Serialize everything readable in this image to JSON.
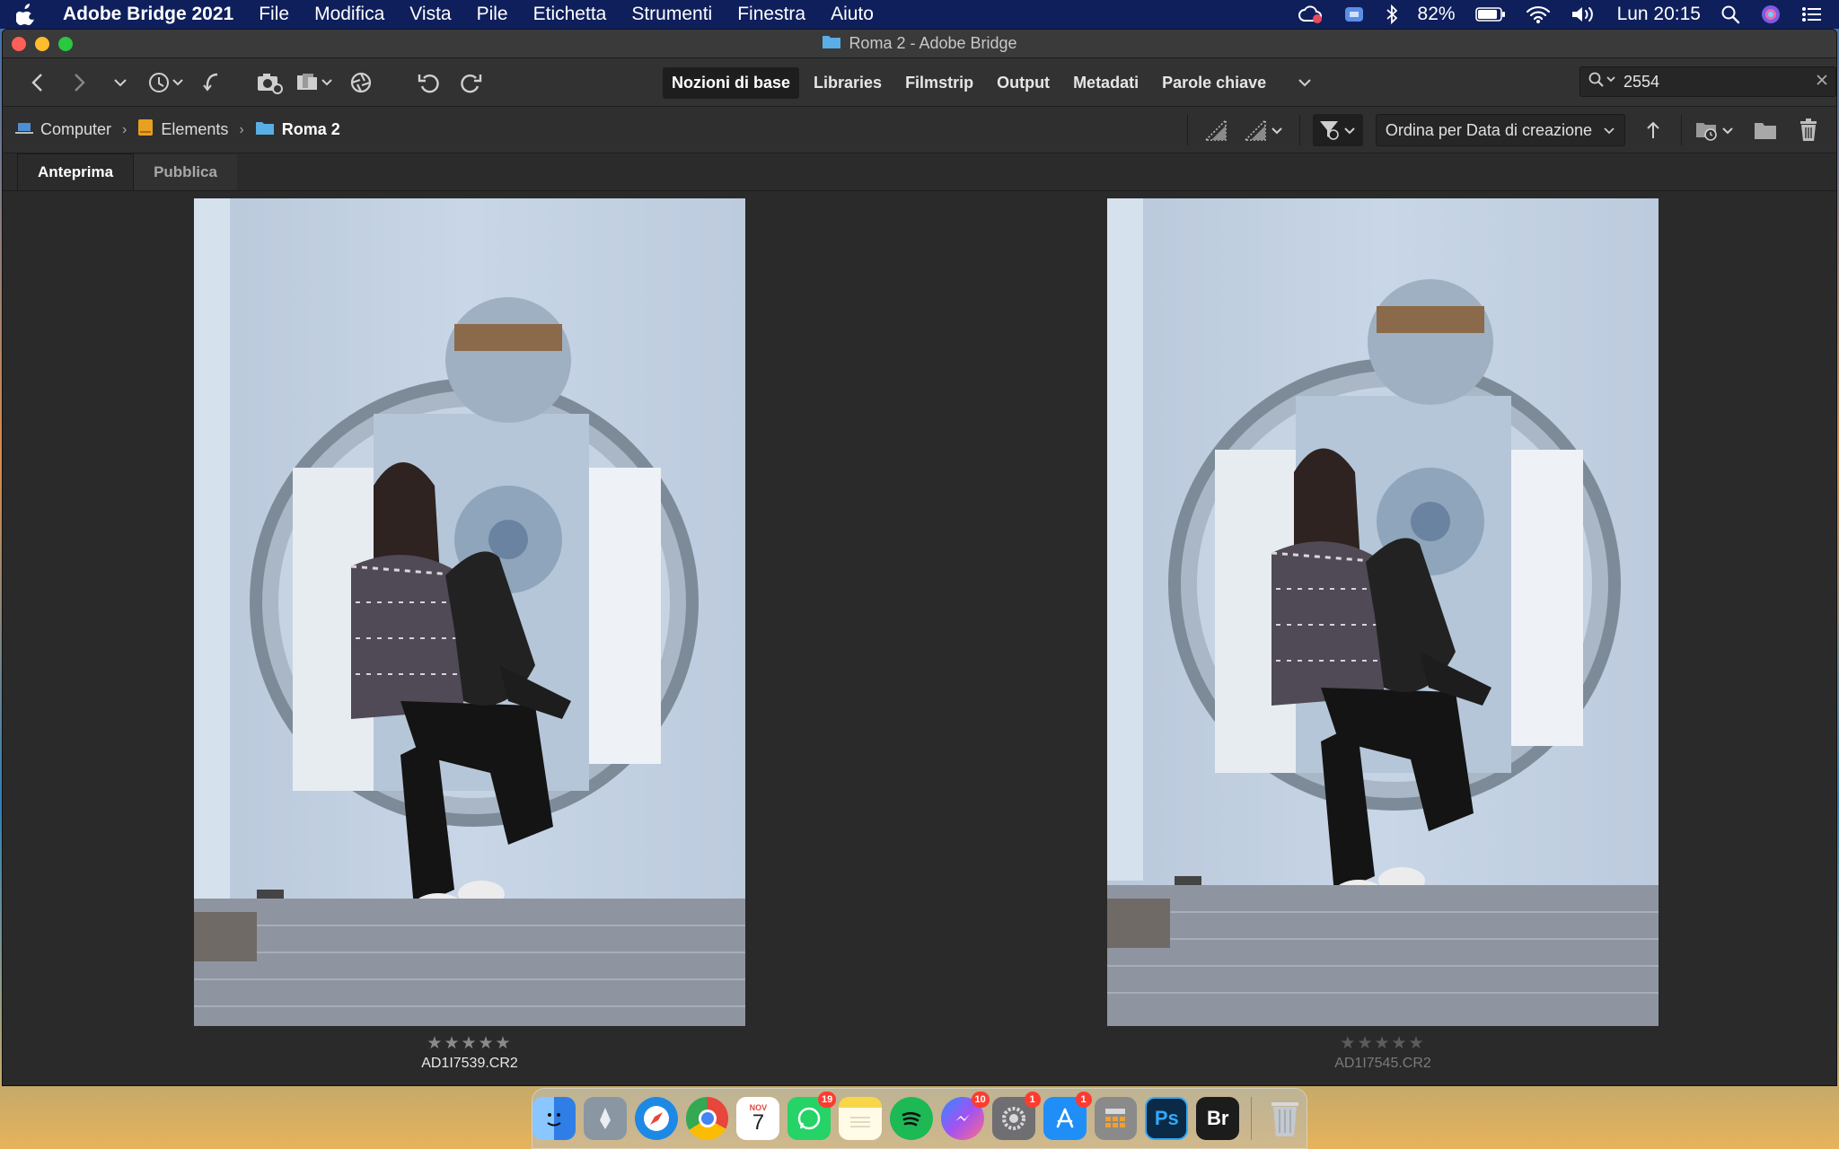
{
  "menubar": {
    "app_name": "Adobe Bridge 2021",
    "items": [
      "File",
      "Modifica",
      "Vista",
      "Pile",
      "Etichetta",
      "Strumenti",
      "Finestra",
      "Aiuto"
    ],
    "battery": "82%",
    "clock": "Lun 20:15"
  },
  "window": {
    "title": "Roma 2 - Adobe Bridge"
  },
  "toolbar": {
    "workspaces": [
      "Nozioni di base",
      "Libraries",
      "Filmstrip",
      "Output",
      "Metadati",
      "Parole chiave"
    ],
    "active_workspace": 0,
    "search_value": "2554"
  },
  "pathbar": {
    "crumbs": [
      "Computer",
      "Elements",
      "Roma 2"
    ],
    "sort_label": "Ordina per Data di creazione"
  },
  "tabs": [
    "Anteprima",
    "Pubblica"
  ],
  "preview": {
    "items": [
      {
        "filename": "AD1I7539.CR2",
        "stars": "★★★★★",
        "rating": 0,
        "selected": true
      },
      {
        "filename": "AD1I7545.CR2",
        "stars": "★★★★★",
        "rating": 0,
        "selected": false
      }
    ]
  },
  "dock": {
    "apps": [
      {
        "name": "finder-icon",
        "color": "#3f8fe8",
        "label": ""
      },
      {
        "name": "launchpad-icon",
        "color": "#7b8794",
        "label": ""
      },
      {
        "name": "safari-icon",
        "color": "#1e88e5",
        "label": ""
      },
      {
        "name": "chrome-icon",
        "color": "#e8453c",
        "label": ""
      },
      {
        "name": "calendar-icon",
        "color": "#ffffff",
        "label": "7",
        "sub": "NOV"
      },
      {
        "name": "whatsapp-icon",
        "color": "#25d366",
        "label": "",
        "badge": "19"
      },
      {
        "name": "notes-icon",
        "color": "#f7d64a",
        "label": ""
      },
      {
        "name": "spotify-icon",
        "color": "#1db954",
        "label": ""
      },
      {
        "name": "messenger-icon",
        "color": "#a152f2",
        "label": "",
        "badge": "10"
      },
      {
        "name": "system-preferences-icon",
        "color": "#6e6e73",
        "label": "",
        "badge": "1"
      },
      {
        "name": "app-store-icon",
        "color": "#1f8ff7",
        "label": "",
        "badge": "1"
      },
      {
        "name": "calculator-icon",
        "color": "#8a8a8a",
        "label": ""
      },
      {
        "name": "photoshop-icon",
        "color": "#0b2a45",
        "label": "Ps"
      },
      {
        "name": "bridge-icon",
        "color": "#1c1c1c",
        "label": "Br"
      }
    ],
    "trash": "trash-icon"
  }
}
